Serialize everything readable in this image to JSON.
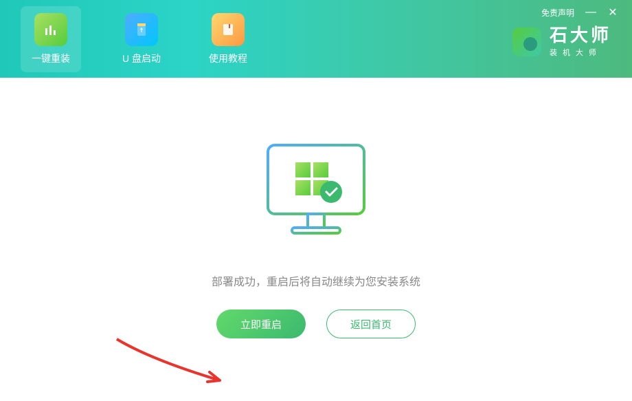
{
  "window": {
    "disclaimer": "免责声明",
    "minimize": "—",
    "close": "✕"
  },
  "nav": {
    "tabs": [
      {
        "label": "一键重装"
      },
      {
        "label": "U 盘启动"
      },
      {
        "label": "使用教程"
      }
    ]
  },
  "brand": {
    "title": "石大师",
    "subtitle": "装机大师"
  },
  "main": {
    "status_text": "部署成功，重启后将自动继续为您安装系统",
    "restart_button": "立即重启",
    "home_button": "返回首页"
  }
}
